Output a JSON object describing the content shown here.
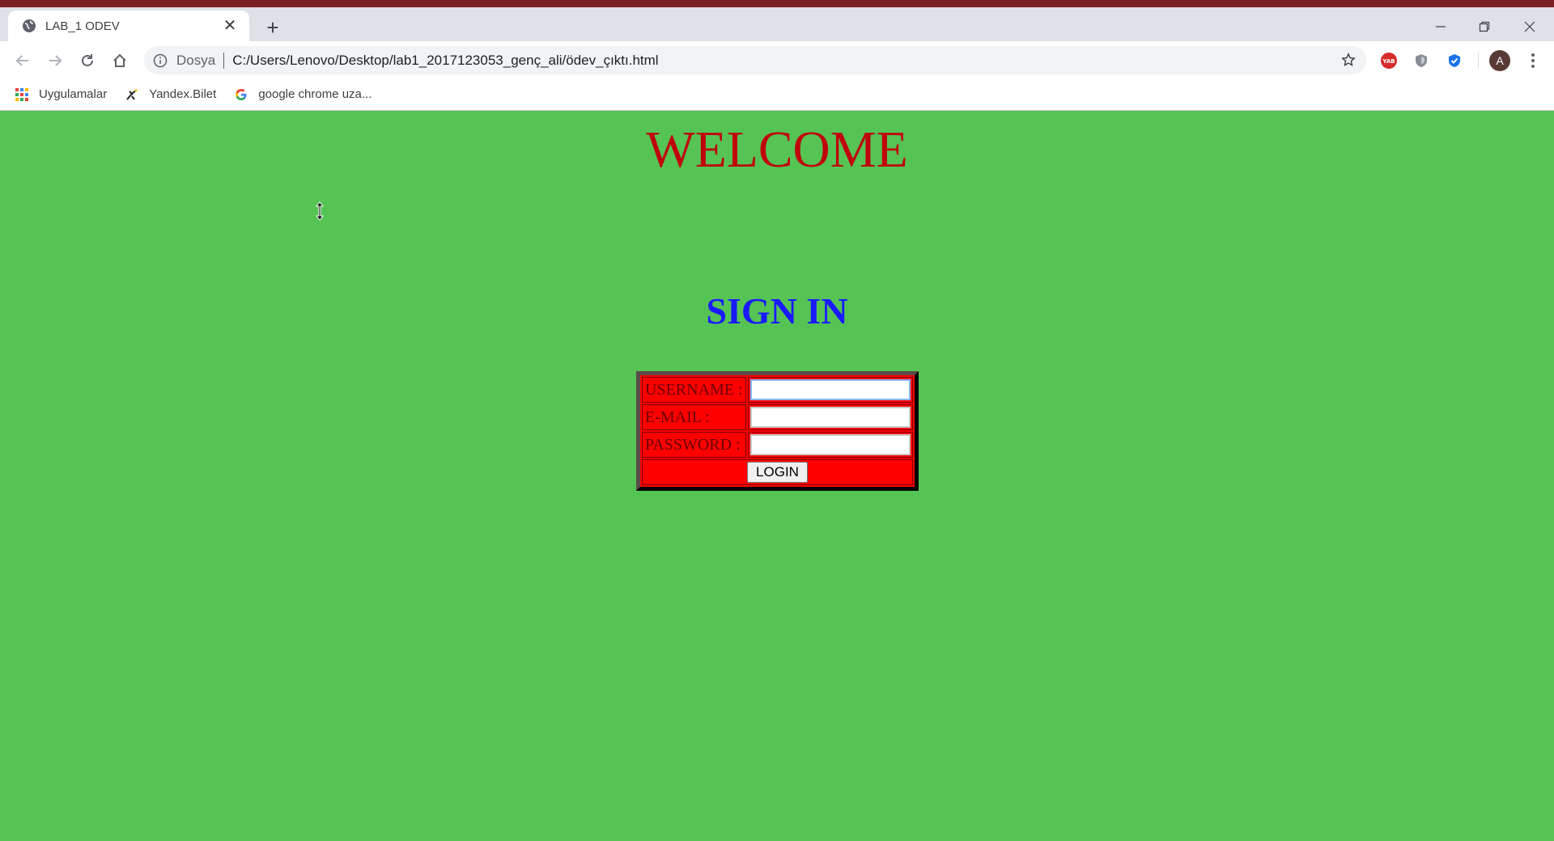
{
  "browser": {
    "tab_title": "LAB_1 ODEV",
    "tab_close": "✕",
    "new_tab": "+",
    "scheme_label": "Dosya",
    "url": "C:/Users/Lenovo/Desktop/lab1_2017123053_genç_ali/ödev_çıktı.html",
    "profile_initial": "A",
    "accent_frame": "#7d1f22"
  },
  "bookmarks": [
    {
      "label": "Uygulamalar",
      "icon": "apps-grid-icon"
    },
    {
      "label": "Yandex.Bilet",
      "icon": "yandex-bilet-icon"
    },
    {
      "label": "google chrome uza...",
      "icon": "google-g-icon"
    }
  ],
  "page": {
    "welcome": "WELCOME",
    "signin": "SIGN IN",
    "background": "#55c455",
    "form": {
      "username_label": "USERNAME :",
      "email_label": "E-MAIL :",
      "password_label": "PASSWORD :",
      "username_value": "",
      "email_value": "",
      "password_value": "",
      "login_label": "LOGIN"
    }
  }
}
